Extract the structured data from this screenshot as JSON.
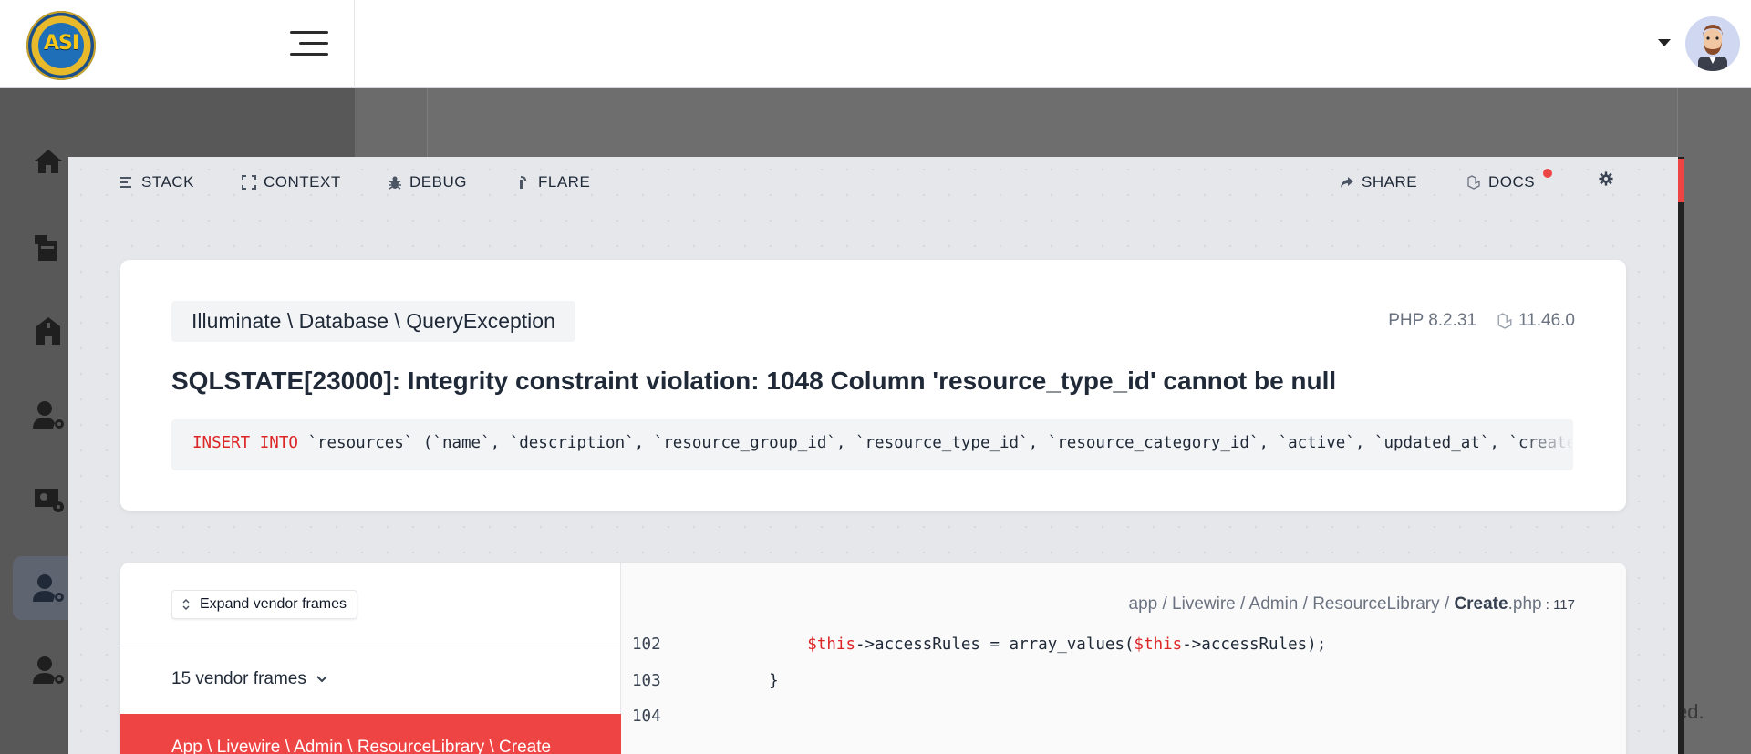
{
  "app": {
    "logo_text": "ASI"
  },
  "overlay": {
    "nav_left": [
      {
        "label": "STACK",
        "icon": "stack-icon"
      },
      {
        "label": "CONTEXT",
        "icon": "expand-icon"
      },
      {
        "label": "DEBUG",
        "icon": "bug-icon"
      },
      {
        "label": "FLARE",
        "icon": "flare-icon"
      }
    ],
    "nav_right": [
      {
        "label": "SHARE",
        "icon": "share-icon"
      },
      {
        "label": "DOCS",
        "icon": "laravel-icon"
      }
    ],
    "settings_icon": "gear-icon",
    "accent_color": "#ef4444"
  },
  "exception": {
    "class": "Illuminate \\ Database \\ QueryException",
    "php_version": "PHP 8.2.31",
    "laravel_version": "11.46.0",
    "message": "SQLSTATE[23000]: Integrity constraint violation: 1048 Column 'resource_type_id' cannot be null",
    "sql_keyword": "INSERT INTO",
    "sql_rest": " `resources` (`name`, `description`, `resource_group_id`, `resource_type_id`, `resource_category_id`, `active`, `updated_at`, `created_at`) values"
  },
  "stack": {
    "expand_label": "Expand vendor frames",
    "vendor_frames_label": "15 vendor frames",
    "active_frame": "App \\ Livewire \\ Admin \\ ResourceLibrary \\ Create",
    "file_path_prefix": "app / Livewire / Admin / ResourceLibrary / ",
    "file_name": "Create",
    "file_ext": ".php",
    "file_line": " : 117",
    "code": [
      {
        "line": "102",
        "parts": [
          [
            "var",
            "$this"
          ],
          [
            "txt",
            "->accessRules = array_values("
          ],
          [
            "var",
            "$this"
          ],
          [
            "txt",
            "->accessRules);"
          ]
        ],
        "indent": "        "
      },
      {
        "line": "103",
        "parts": [
          [
            "txt",
            "}"
          ]
        ],
        "indent": "    "
      },
      {
        "line": "104",
        "parts": [],
        "indent": ""
      }
    ]
  },
  "background": {
    "trailing_text": "ed."
  }
}
